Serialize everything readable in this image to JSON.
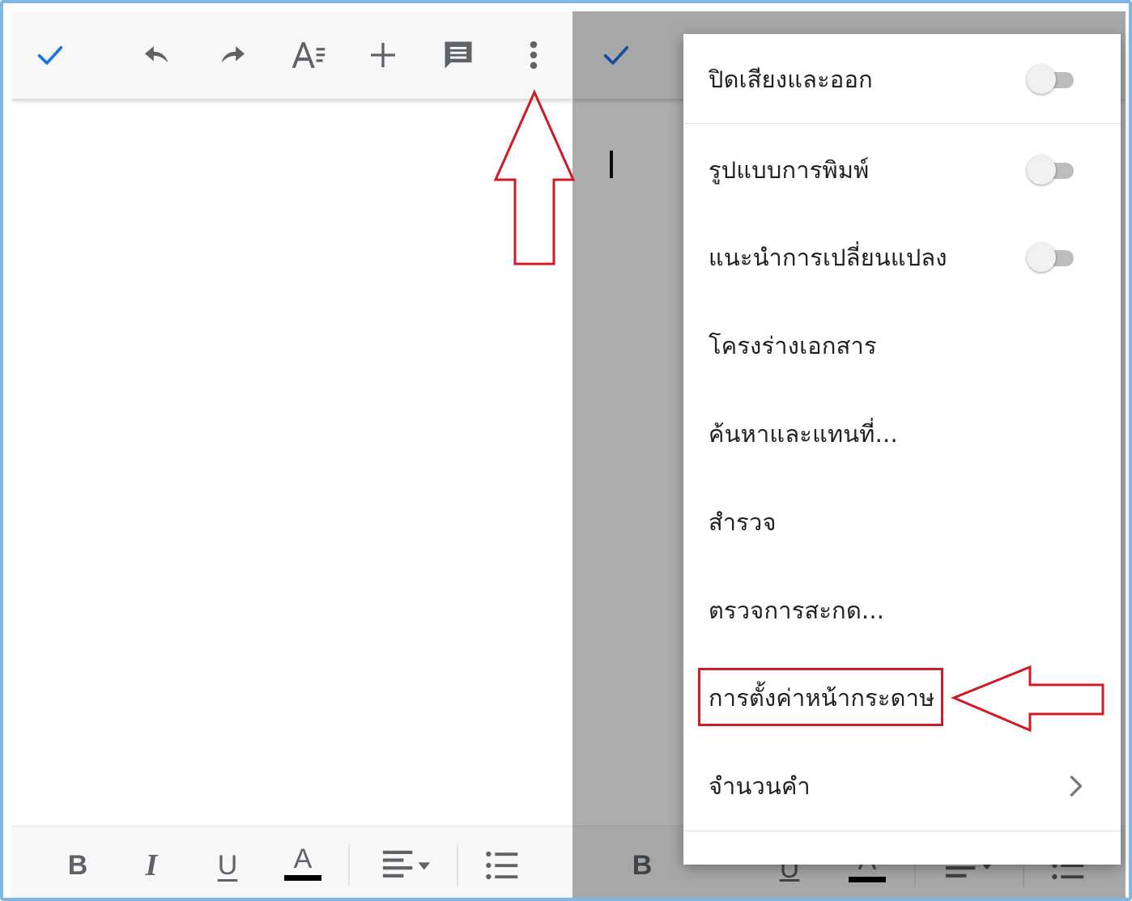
{
  "colors": {
    "accent_check": "#1a73e8",
    "icon_gray": "#5f6368",
    "annotation_red": "#d01a24",
    "frame_blue": "#7fb7e2",
    "toolbar_bg": "#f7f7f7",
    "overlay_dim": "rgba(0,0,0,0.32)"
  },
  "top_toolbar": {
    "icons": [
      "check-icon",
      "undo-icon",
      "redo-icon",
      "text-format-icon",
      "insert-plus-icon",
      "comment-icon",
      "more-vert-icon"
    ]
  },
  "bottom_toolbar": {
    "bold_label": "B",
    "italic_label": "I",
    "underline_label": "U",
    "textcolor_label": "A",
    "icons": [
      "bold-icon",
      "italic-icon",
      "underline-icon",
      "text-color-icon",
      "align-left-icon",
      "bulleted-list-icon"
    ]
  },
  "menu": {
    "items": [
      {
        "label": "ปิดเสียงและออก",
        "toggle": true,
        "on": false
      },
      {
        "label": "รูปแบบการพิมพ์",
        "toggle": true,
        "on": false
      },
      {
        "label": "แนะนำการเปลี่ยนแปลง",
        "toggle": true,
        "on": false
      },
      {
        "label": "โครงร่างเอกสาร"
      },
      {
        "label": "ค้นหาและแทนที่..."
      },
      {
        "label": "สำรวจ"
      },
      {
        "label": "ตรวจการสะกด..."
      },
      {
        "label": "การตั้งค่าหน้ากระดาษ",
        "highlighted": true
      },
      {
        "label": "จำนวนคำ",
        "submenu": true
      }
    ]
  }
}
